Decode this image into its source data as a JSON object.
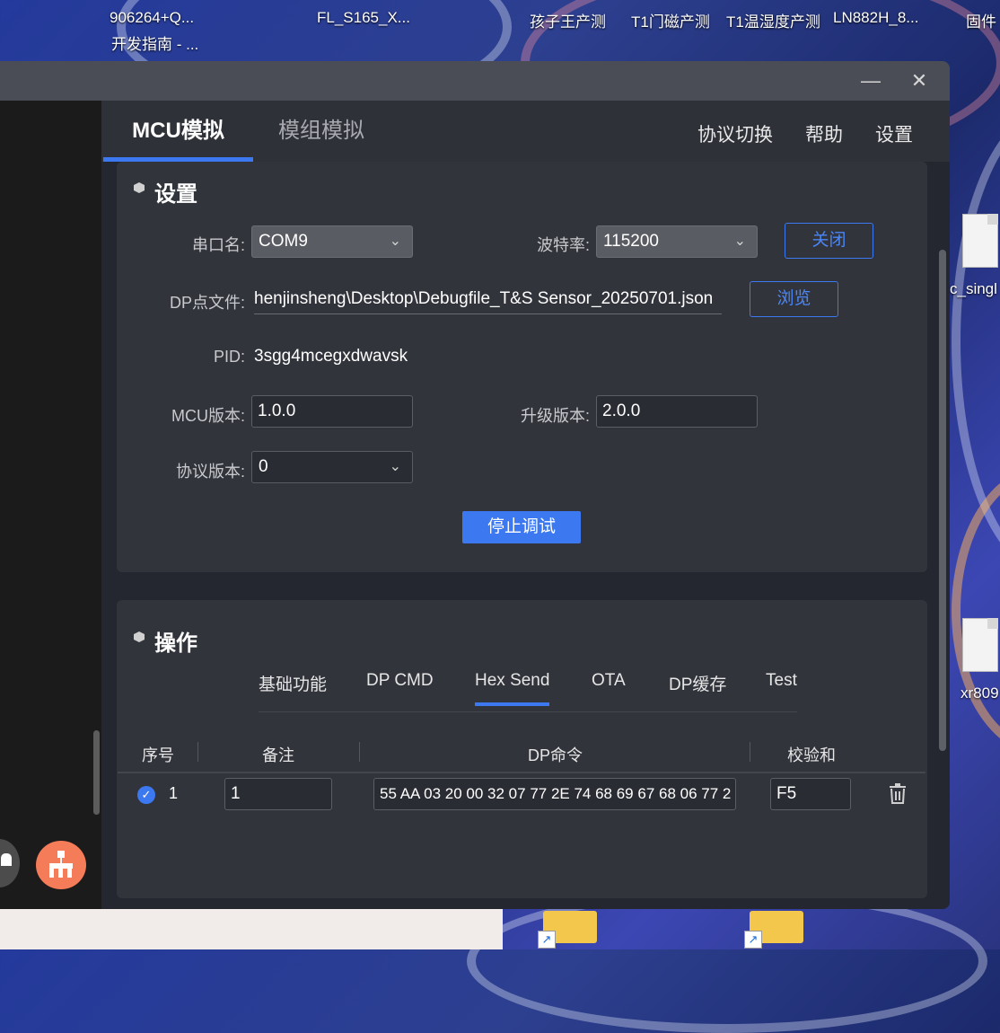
{
  "desktop": {
    "icons": [
      {
        "label": "906264+Q...",
        "sublabel": "开发指南 - ..."
      },
      {
        "label": "FL_S165_X..."
      },
      {
        "label": "孩子王产测"
      },
      {
        "label": "T1门磁产测"
      },
      {
        "label": "T1温湿度产测"
      },
      {
        "label": "LN882H_8..."
      },
      {
        "label": "固件"
      },
      {
        "label": "c_singl"
      },
      {
        "label": "xr809"
      }
    ]
  },
  "window": {
    "minimize_icon": "minimize-icon",
    "close_icon": "close-icon"
  },
  "tabs": [
    "MCU模拟",
    "模组模拟"
  ],
  "menu": [
    "协议切换",
    "帮助",
    "设置"
  ],
  "settings": {
    "title": "设置",
    "port_label": "串口名:",
    "port_value": "COM9",
    "baud_label": "波特率:",
    "baud_value": "115200",
    "close_button": "关闭",
    "dp_file_label": "DP点文件:",
    "dp_file_value": "henjinsheng\\Desktop\\Debugfile_T&S Sensor_20250701.json",
    "browse_button": "浏览",
    "pid_label": "PID:",
    "pid_value": "3sgg4mcegxdwavsk",
    "mcu_version_label": "MCU版本:",
    "mcu_version_value": "1.0.0",
    "upgrade_version_label": "升级版本:",
    "upgrade_version_value": "2.0.0",
    "protocol_version_label": "协议版本:",
    "protocol_version_value": "0",
    "stop_button": "停止调试"
  },
  "operation": {
    "title": "操作",
    "subtabs": [
      "基础功能",
      "DP CMD",
      "Hex Send",
      "OTA",
      "DP缓存",
      "Test"
    ],
    "active_subtab": "Hex Send",
    "columns": [
      "序号",
      "备注",
      "DP命令",
      "校验和"
    ],
    "rows": [
      {
        "index": "1",
        "note": "1",
        "command": "55 AA 03 20 00 32 07 77 2E 74 68 69 67 68 06 77 2",
        "checksum": "F5",
        "checked": true
      }
    ]
  },
  "colors": {
    "accent": "#3c78f0",
    "panel": "#32343c",
    "background": "#252730"
  }
}
